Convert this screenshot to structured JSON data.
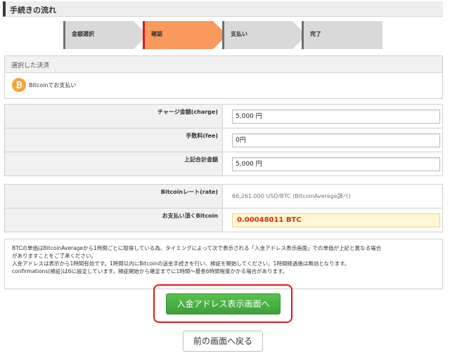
{
  "section": {
    "title": "手続きの流れ"
  },
  "steps": [
    {
      "label": "金額選択",
      "state": "done"
    },
    {
      "label": "確認",
      "state": "active"
    },
    {
      "label": "支払い",
      "state": "pending"
    },
    {
      "label": "完了",
      "state": "pending"
    }
  ],
  "payment": {
    "header": "選択した決済",
    "icon": "bitcoin-icon",
    "icon_glyph": "₿",
    "method_text": "Bitcoinでお支払い"
  },
  "amounts": {
    "charge_label": "チャージ金額(charge)",
    "charge_value": "5,000 円",
    "fee_label": "手数料(fee)",
    "fee_value": "0円",
    "total_label": "上記合計金額",
    "total_value": "5,000 円"
  },
  "rate": {
    "rate_label": "Bitcoinレート(rate)",
    "rate_value": "66,261.000 USD/BTC (BitcoinAverage調べ)",
    "pay_label": "お支払い頂くBitcoin",
    "pay_value": "0.00048011 BTC"
  },
  "notice": {
    "lines": [
      "BTCの単価はBitcoinAverageから1時間ごとに取得している為、タイミングによって次で表示される「入金アドレス表示画面」での単価が上記と異なる場合",
      "がありますことをご了承ください。",
      "入金アドレスは表示から1時間有効です。1時間以内にBitcoinの送金手続きを行い、検証を開始してください。1時間経過後は無効となります。",
      "confirmations(検証)は6に設定しています。検証開始から確定までに1時間〜最長6時間程度かかる場合があります。"
    ]
  },
  "buttons": {
    "proceed": "入金アドレス表示画面へ",
    "back": "前の画面へ戻る"
  },
  "colors": {
    "step_active": "#f79a5b",
    "step_default": "#d9d9d9",
    "button_green": "#4cb047",
    "highlight_red": "#d91b1b",
    "btc_orange": "#f2a33a"
  }
}
